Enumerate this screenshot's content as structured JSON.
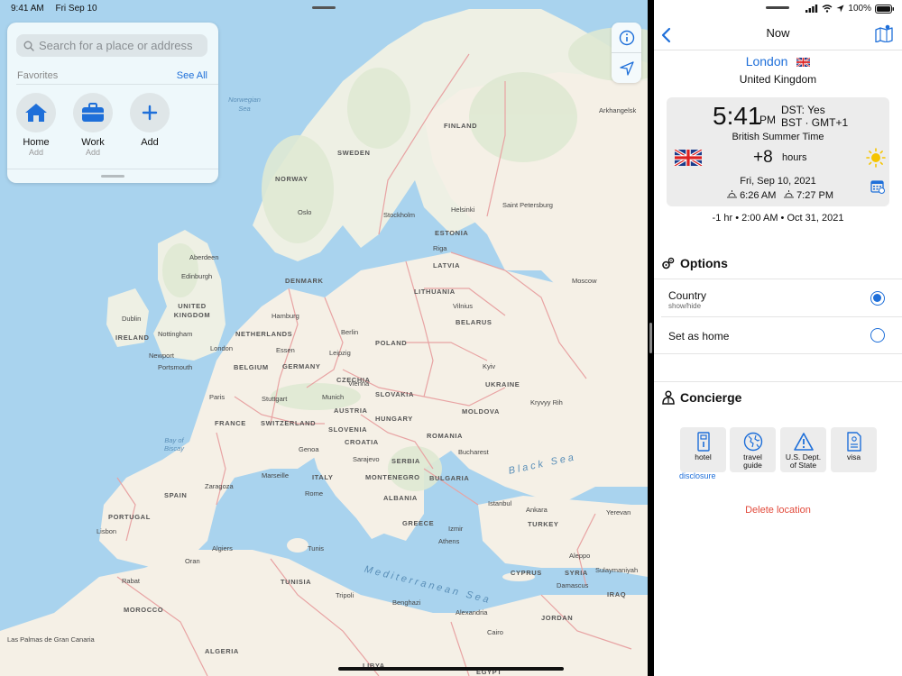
{
  "status_bar": {
    "time": "9:41 AM",
    "date": "Fri Sep 10",
    "battery": "100%"
  },
  "search": {
    "placeholder": "Search for a place or address"
  },
  "favorites": {
    "title": "Favorites",
    "see_all": "See All",
    "items": [
      {
        "label": "Home",
        "sub": "Add",
        "icon": "house-icon"
      },
      {
        "label": "Work",
        "sub": "Add",
        "icon": "briefcase-icon"
      },
      {
        "label": "Add",
        "sub": "",
        "icon": "plus-icon"
      }
    ]
  },
  "map": {
    "countries": [
      "NORWAY",
      "SWEDEN",
      "FINLAND",
      "ESTONIA",
      "LATVIA",
      "LITHUANIA",
      "DENMARK",
      "UNITED KINGDOM",
      "IRELAND",
      "NETHERLANDS",
      "BELGIUM",
      "GERMANY",
      "POLAND",
      "BELARUS",
      "UKRAINE",
      "CZECHIA",
      "SLOVAKIA",
      "AUSTRIA",
      "HUNGARY",
      "MOLDOVA",
      "ROMANIA",
      "FRANCE",
      "SWITZERLAND",
      "SLOVENIA",
      "CROATIA",
      "SERBIA",
      "BULGARIA",
      "MONTENEGRO",
      "ALBANIA",
      "ITALY",
      "SPAIN",
      "PORTUGAL",
      "GREECE",
      "TURKEY",
      "CYPRUS",
      "SYRIA",
      "IRAQ",
      "JORDAN",
      "TUNISIA",
      "MOROCCO",
      "ALGERIA",
      "LIBYA",
      "EGYPT"
    ],
    "cities": [
      "Aberdeen",
      "Edinburgh",
      "Dublin",
      "Nottingham",
      "Newport",
      "London",
      "Portsmouth",
      "Hamburg",
      "Berlin",
      "Essen",
      "Leipzig",
      "Paris",
      "Stuttgart",
      "Munich",
      "Vienna",
      "Kyiv",
      "Kryvyy Rih",
      "Oslo",
      "Stockholm",
      "Helsinki",
      "Saint Petersburg",
      "Arkhangelsk",
      "Moscow",
      "Riga",
      "Vilnius",
      "Bucharest",
      "Genoa",
      "Marseille",
      "Zaragoza",
      "Rome",
      "Sarajevo",
      "Istanbul",
      "Ankara",
      "Izmir",
      "Athens",
      "Lisbon",
      "Algiers",
      "Oran",
      "Tunis",
      "Rabat",
      "Tripoli",
      "Benghazi",
      "Alexandria",
      "Cairo",
      "Aleppo",
      "Damascus",
      "Sulaymaniyah",
      "Yerevan",
      "Las Palmas de Gran Canaria"
    ],
    "seas": [
      "Norwegian Sea",
      "Bay of Biscay",
      "Black Sea",
      "Mediterranean Sea"
    ]
  },
  "detail": {
    "nav_title": "Now",
    "city": "London",
    "country": "United Kingdom",
    "time": "5:41",
    "ampm": "PM",
    "dst": "DST: Yes",
    "tz_abbr": "BST · GMT+1",
    "tz_name": "British Summer Time",
    "offset": "+8",
    "offset_unit": "hours",
    "date": "Fri, Sep 10, 2021",
    "sunrise": "6:26 AM",
    "sunset": "7:27 PM",
    "dst_change": "-1 hr • 2:00 AM • Oct 31, 2021"
  },
  "options": {
    "title": "Options",
    "items": [
      {
        "label": "Country",
        "sub": "show/hide",
        "selected": true
      },
      {
        "label": "Set as home",
        "sub": "",
        "selected": false
      }
    ]
  },
  "concierge": {
    "title": "Concierge",
    "buttons": [
      {
        "label": "hotel",
        "icon": "door-icon"
      },
      {
        "label": "travel guide",
        "icon": "globe-icon"
      },
      {
        "label": "U.S. Dept. of State",
        "icon": "warning-icon"
      },
      {
        "label": "visa",
        "icon": "document-icon"
      }
    ],
    "disclosure": "disclosure",
    "delete": "Delete location"
  },
  "colors": {
    "accent": "#1e6fd9",
    "destructive": "#e24a3b",
    "sea": "#a9d3ee",
    "land": "#f5f0e6",
    "border": "#e8a3a3"
  }
}
